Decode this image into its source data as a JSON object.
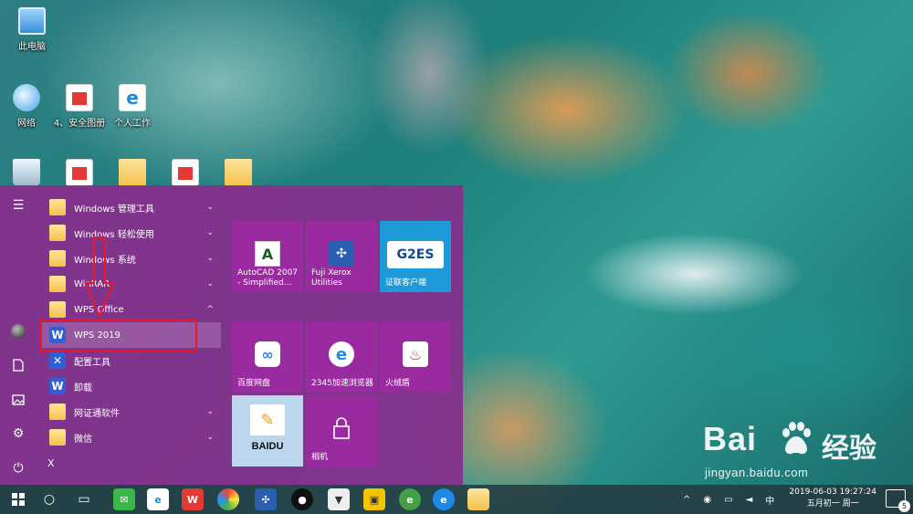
{
  "desktop": {
    "icons": [
      {
        "label": "此电脑",
        "icon": "computer-icon"
      },
      {
        "label": "网络",
        "icon": "network-icon"
      },
      {
        "label": "4、安全图册",
        "icon": "pdf-document-icon"
      },
      {
        "label": "个人工作",
        "icon": "ie-shortcut-icon"
      },
      {
        "label": "",
        "icon": "recycle-bin-icon"
      },
      {
        "label": "",
        "icon": "document-icon"
      },
      {
        "label": "",
        "icon": "folder-icon"
      },
      {
        "label": "",
        "icon": "document-icon"
      },
      {
        "label": "",
        "icon": "folder-icon"
      }
    ]
  },
  "start_menu": {
    "rail": {
      "menu_icon": "hamburger-icon",
      "user_icon": "avatar",
      "documents_icon": "document-icon",
      "pictures_icon": "pictures-icon",
      "settings_icon": "gear-icon",
      "power_icon": "power-icon"
    },
    "app_list": [
      {
        "label": "Windows 管理工具",
        "icon": "folder-icon",
        "chevron": "⌄"
      },
      {
        "label": "Windows 轻松使用",
        "icon": "folder-icon",
        "chevron": "⌄"
      },
      {
        "label": "Windows 系统",
        "icon": "folder-icon",
        "chevron": "⌄"
      },
      {
        "label": "WinRAR",
        "icon": "folder-icon",
        "chevron": "⌄"
      },
      {
        "label": "WPS Office",
        "icon": "folder-icon",
        "chevron": "^"
      },
      {
        "label": "WPS 2019",
        "icon": "wps-icon",
        "chevron": ""
      },
      {
        "label": "配置工具",
        "icon": "wrench-icon",
        "chevron": ""
      },
      {
        "label": "卸载",
        "icon": "wps-icon",
        "chevron": ""
      },
      {
        "label": "网证通软件",
        "icon": "folder-icon",
        "chevron": "⌄"
      },
      {
        "label": "微信",
        "icon": "folder-icon",
        "chevron": "⌄"
      },
      {
        "label": "X",
        "icon": "",
        "chevron": ""
      }
    ],
    "tiles": [
      {
        "label": "AutoCAD 2007 - Simplified...",
        "icon": "autocad-icon"
      },
      {
        "label": "Fuji Xerox Utilities",
        "icon": "fuji-xerox-icon"
      },
      {
        "label": "证联客户端",
        "icon": "g2es-icon",
        "logo_text": "G2ES"
      },
      {
        "label": "百度网盘",
        "icon": "baidu-netdisk-icon"
      },
      {
        "label": "2345加速浏览器",
        "icon": "browser-2345-icon"
      },
      {
        "label": "火绒盾",
        "icon": "huorong-icon"
      },
      {
        "label": "",
        "icon": "baidu-input-icon",
        "logo_text": "BAIDU"
      },
      {
        "label": "相机",
        "icon": "camera-icon"
      }
    ]
  },
  "taskbar": {
    "start_icon": "windows-start-icon",
    "tray": {
      "input_method": "中",
      "time": "2019-06-03  19:27:24",
      "date_lunar": "五月初一 周一",
      "notification_count": "5"
    }
  },
  "watermark": {
    "brand": "Bai",
    "brand_cn": "经验",
    "url": "jingyan.baidu.com"
  },
  "colors": {
    "start_menu_bg": "#86308c",
    "tile_purple": "#9a2aa0",
    "highlight_red": "#e8182a",
    "taskbar_bg": "#24343c"
  }
}
